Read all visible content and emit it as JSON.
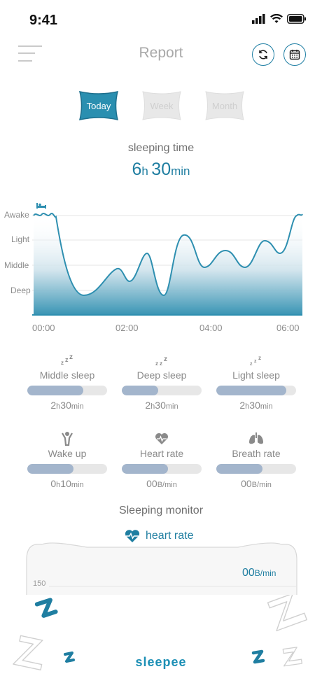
{
  "status_bar": {
    "time": "9:41"
  },
  "header": {
    "title": "Report"
  },
  "tabs": [
    {
      "label": "Today",
      "active": true
    },
    {
      "label": "Week",
      "active": false
    },
    {
      "label": "Month",
      "active": false
    }
  ],
  "sleeping_time": {
    "label": "sleeping time",
    "hours": "6",
    "hours_unit": "h",
    "minutes": "30",
    "minutes_unit": "min"
  },
  "chart": {
    "y_labels": [
      "Awake",
      "Light",
      "Middle",
      "Deep"
    ],
    "x_labels": [
      "00:00",
      "02:00",
      "04:00",
      "06:00"
    ],
    "accent": "#2e8fb0"
  },
  "stats": [
    {
      "label": "Middle sleep",
      "num1": "2",
      "unit1": "h",
      "num2": "30",
      "unit2": "min",
      "icon": "middle-sleep-icon",
      "fill": 0.7
    },
    {
      "label": "Deep sleep",
      "num1": "2",
      "unit1": "h",
      "num2": "30",
      "unit2": "min",
      "icon": "deep-sleep-icon",
      "fill": 0.46
    },
    {
      "label": "Light sleep",
      "num1": "2",
      "unit1": "h",
      "num2": "30",
      "unit2": "min",
      "icon": "light-sleep-icon",
      "fill": 0.88
    },
    {
      "label": "Wake up",
      "num1": "0",
      "unit1": "h",
      "num2": "10",
      "unit2": "min",
      "icon": "wake-up-icon",
      "fill": 0.58
    },
    {
      "label": "Heart rate",
      "num1": "00",
      "unit1": "B/min",
      "num2": "",
      "unit2": "",
      "icon": "heart-rate-icon",
      "fill": 0.58
    },
    {
      "label": "Breath rate",
      "num1": "00",
      "unit1": "B/min",
      "num2": "",
      "unit2": "",
      "icon": "lungs-icon",
      "fill": 0.58
    }
  ],
  "monitor": {
    "title": "Sleeping monitor",
    "tab_label": "heart rate",
    "value": "00",
    "unit": "B/min",
    "axis_label": "150"
  },
  "brand": "sleepee",
  "colors": {
    "accent": "#1f7ea1",
    "bar_fill": "#a3b5cc",
    "bar_track": "#e7e7e7"
  }
}
